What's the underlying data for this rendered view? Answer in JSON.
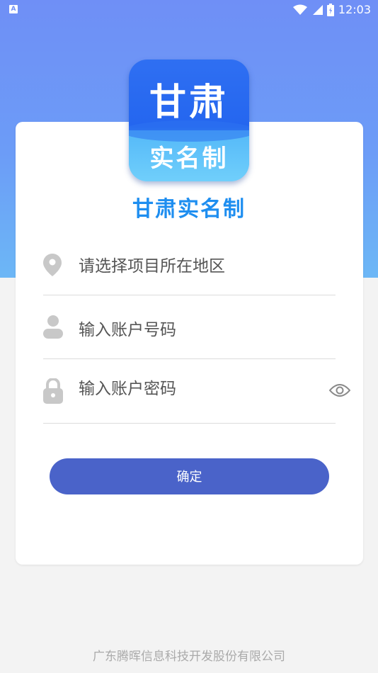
{
  "status_bar": {
    "left_icon": "A",
    "time": "12:03",
    "icons": [
      "wifi-icon",
      "signal-icon",
      "battery-icon"
    ]
  },
  "logo": {
    "top_text": "甘肃",
    "bottom_text": "实名制"
  },
  "app_title": "甘肃实名制",
  "form": {
    "project_placeholder": "请选择项目所在地区",
    "account_placeholder": "输入账户号码",
    "password_placeholder": "输入账户密码",
    "confirm_label": "确定"
  },
  "footer": "广东腾晖信息科技开发股份有限公司",
  "colors": {
    "header_gradient_top": "#6f8ff6",
    "header_gradient_bottom": "#6cb7f6",
    "title": "#1e8ef0",
    "button": "#4a63c9"
  }
}
